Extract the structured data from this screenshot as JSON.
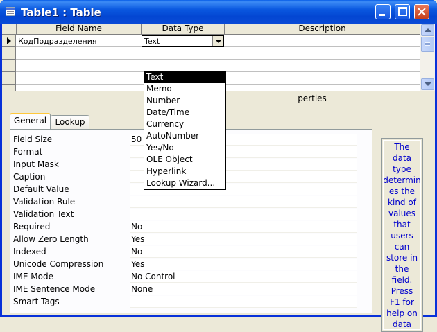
{
  "window": {
    "title": "Table1 : Table"
  },
  "grid": {
    "headers": [
      "Field Name",
      "Data Type",
      "Description"
    ],
    "rows": [
      {
        "field_name": "КодПодразделения",
        "data_type": "Text",
        "description": ""
      }
    ]
  },
  "datatype_options": [
    "Text",
    "Memo",
    "Number",
    "Date/Time",
    "Currency",
    "AutoNumber",
    "Yes/No",
    "OLE Object",
    "Hyperlink",
    "Lookup Wizard..."
  ],
  "datatype_selected": "Text",
  "field_properties": {
    "caption": "Field Properties",
    "caption_visible": "perties",
    "tabs": [
      "General",
      "Lookup"
    ],
    "active_tab": "General",
    "rows": [
      {
        "label": "Field Size",
        "value": "50"
      },
      {
        "label": "Format",
        "value": ""
      },
      {
        "label": "Input Mask",
        "value": ""
      },
      {
        "label": "Caption",
        "value": ""
      },
      {
        "label": "Default Value",
        "value": ""
      },
      {
        "label": "Validation Rule",
        "value": ""
      },
      {
        "label": "Validation Text",
        "value": ""
      },
      {
        "label": "Required",
        "value": "No"
      },
      {
        "label": "Allow Zero Length",
        "value": "Yes"
      },
      {
        "label": "Indexed",
        "value": "No"
      },
      {
        "label": "Unicode Compression",
        "value": "Yes"
      },
      {
        "label": "IME Mode",
        "value": "No Control"
      },
      {
        "label": "IME Sentence Mode",
        "value": "None"
      },
      {
        "label": "Smart Tags",
        "value": ""
      }
    ]
  },
  "help_text_lines": [
    "The",
    "data",
    "type",
    "determin",
    "es the",
    "kind of",
    "values",
    "that",
    "users",
    "can",
    "store in",
    "the",
    "field.",
    "Press",
    "F1 for",
    "help on",
    "data"
  ],
  "icons": {
    "app": "table-icon",
    "minimize": "minimize-icon",
    "maximize": "maximize-icon",
    "close": "close-icon",
    "row_selector": "current-row-arrow-icon",
    "dropdown": "chevron-down-icon"
  },
  "colors": {
    "titlebar": "#0a58e0",
    "face": "#ece9d8",
    "selection": "#000000",
    "help_text": "#0000cc",
    "tab_highlight": "#ffc83c"
  }
}
